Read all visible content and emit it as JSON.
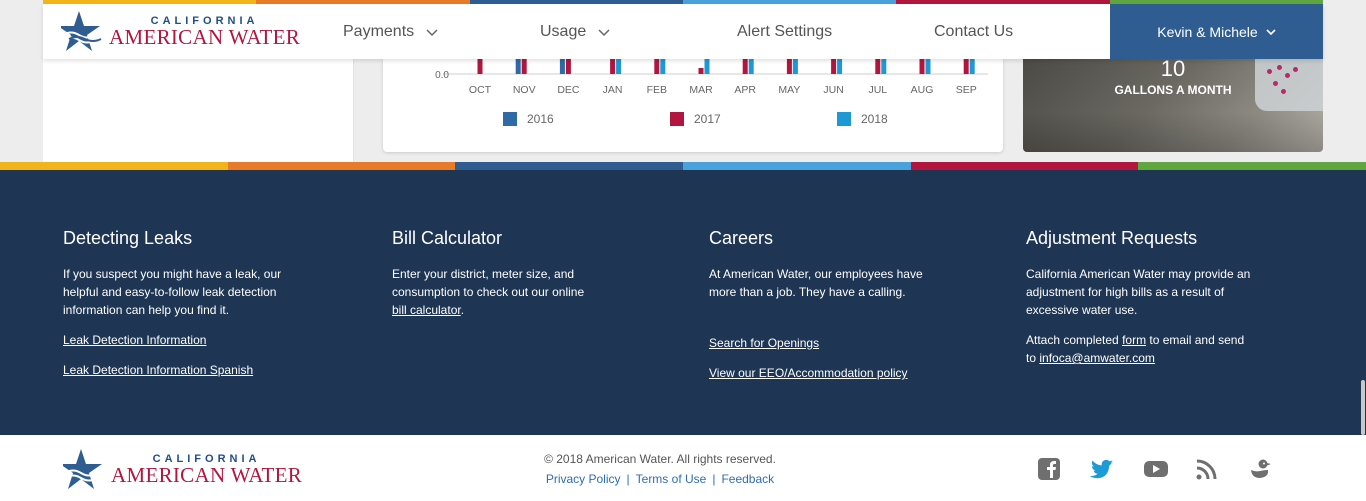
{
  "brand": {
    "line1": "CALIFORNIA",
    "line2": "AMERICAN WATER",
    "stripe_colors": [
      "#f2b519",
      "#e77b2a",
      "#2f5d92",
      "#4aa2dc",
      "#b2163f",
      "#5fa641"
    ]
  },
  "nav": {
    "items": [
      {
        "label": "Payments",
        "dropdown": true
      },
      {
        "label": "Usage",
        "dropdown": true
      },
      {
        "label": "Alert Settings",
        "dropdown": false
      },
      {
        "label": "Contact Us",
        "dropdown": false
      }
    ],
    "user_label": "Kevin & Michele",
    "user_bg": "#2f5d92"
  },
  "chart_data": {
    "type": "bar",
    "categories": [
      "OCT",
      "NOV",
      "DEC",
      "JAN",
      "FEB",
      "MAR",
      "APR",
      "MAY",
      "JUN",
      "JUL",
      "AUG",
      "SEP"
    ],
    "series": [
      {
        "name": "2016",
        "color": "#2f6aa6",
        "values": [
          null,
          1,
          1,
          null,
          null,
          null,
          null,
          null,
          null,
          null,
          null,
          null
        ]
      },
      {
        "name": "2017",
        "color": "#b2163f",
        "values": [
          1,
          1,
          1,
          1,
          1,
          0.1,
          1,
          1,
          1,
          1,
          1,
          1
        ]
      },
      {
        "name": "2018",
        "color": "#1d9ad6",
        "values": [
          null,
          null,
          null,
          1,
          1,
          1,
          1,
          1,
          1,
          1,
          1,
          1
        ]
      }
    ],
    "y_tick_label": "0.0",
    "legend_position": "bottom"
  },
  "promo": {
    "number": "10",
    "caption": "GALLONS A MONTH"
  },
  "footer": {
    "columns": [
      {
        "title": "Detecting Leaks",
        "text": "If you suspect you might have a leak, our helpful and easy-to-follow leak detection information can help you find it.",
        "links": [
          "Leak Detection Information",
          "Leak Detection Information Spanish"
        ]
      },
      {
        "title": "Bill Calculator",
        "text_before": "Enter your district, meter size, and consumption to check out our online",
        "link": "bill calculator",
        "text_after": "."
      },
      {
        "title": "Careers",
        "text": "At American Water, our employees have more than a job. They have a calling.",
        "links": [
          "Search for Openings",
          "View our EEO/Accommodation policy"
        ]
      },
      {
        "title": "Adjustment Requests",
        "text": "California American Water may provide an adjustment for high bills as a result of excessive water use.",
        "attach_before": "Attach completed",
        "attach_link": "form",
        "attach_middle": "to email and send to",
        "email": "infoca@amwater.com"
      }
    ],
    "bg": "#1e3553"
  },
  "bottom": {
    "copyright": "© 2018 American Water. All rights reserved.",
    "links": [
      "Privacy Policy",
      "Terms of Use",
      "Feedback"
    ],
    "social": [
      "facebook-icon",
      "twitter-icon",
      "youtube-icon",
      "rss-icon",
      "duck-icon"
    ]
  }
}
